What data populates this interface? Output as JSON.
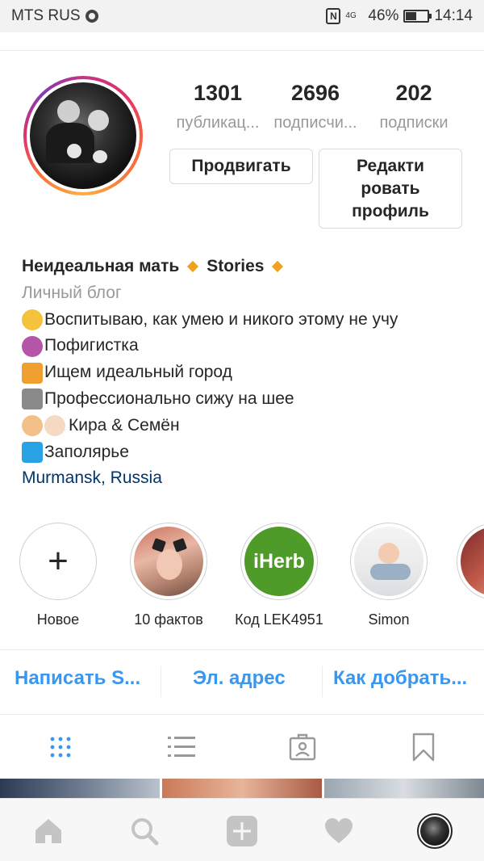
{
  "status_bar": {
    "carrier": "MTS RUS",
    "network": "4G",
    "battery": "46%",
    "battery_level": 0.46,
    "time": "14:14"
  },
  "profile": {
    "stats": [
      {
        "value": "1301",
        "label": "публикац..."
      },
      {
        "value": "2696",
        "label": "подписчи..."
      },
      {
        "value": "202",
        "label": "подписки"
      }
    ],
    "promote_button": "Продвигать",
    "edit_button_lines": [
      "Редакти",
      "ровать",
      "профиль"
    ]
  },
  "bio": {
    "name": "Неидеальная мать",
    "name_suffix": "Stories",
    "category": "Личный блог",
    "lines": [
      {
        "icon": "zipper-mouth-face-icon",
        "color": "#f5c33b",
        "text": "Воспитываю, как умею и никого этому не учу"
      },
      {
        "icon": "woman-facepalming-icon",
        "color": "#b455a8",
        "text": "Пофигистка"
      },
      {
        "icon": "house-icon",
        "color": "#f0a030",
        "text": "Ищем идеальный город"
      },
      {
        "icon": "koala-icon",
        "color": "#8a8a8a",
        "text": "Профессионально сижу на шее"
      },
      {
        "icon": "girl-baby-icon",
        "color": "#f3c089",
        "text": "Кира & Семён"
      },
      {
        "icon": "wind-face-icon",
        "color": "#2aa3e6",
        "text": "Заполярье"
      }
    ],
    "location": "Murmansk, Russia"
  },
  "highlights": [
    {
      "label": "Новое",
      "icon": "plus-icon"
    },
    {
      "label": "10 фактов",
      "icon": "selfie-thumbnail"
    },
    {
      "label": "Код LEK4951",
      "icon": "iherb-logo",
      "logo_text": "iHerb"
    },
    {
      "label": "Simon",
      "icon": "baby-thumbnail"
    },
    {
      "label": "",
      "icon": "partial-thumbnail"
    }
  ],
  "contact_buttons": [
    {
      "label": "Написать S..."
    },
    {
      "label": "Эл. адрес"
    },
    {
      "label": "Как добрать..."
    }
  ],
  "tabs": [
    {
      "icon": "grid-icon",
      "active": true
    },
    {
      "icon": "list-icon",
      "active": false
    },
    {
      "icon": "tagged-icon",
      "active": false
    },
    {
      "icon": "bookmark-icon",
      "active": false
    }
  ],
  "bottom_nav": [
    {
      "icon": "home-icon"
    },
    {
      "icon": "search-icon"
    },
    {
      "icon": "add-post-icon"
    },
    {
      "icon": "heart-icon"
    },
    {
      "icon": "profile-avatar-icon"
    }
  ],
  "colors": {
    "link_blue": "#3897f0",
    "location_blue": "#003569",
    "accent_diamond": "#f0a21e",
    "muted_text": "#999999"
  }
}
